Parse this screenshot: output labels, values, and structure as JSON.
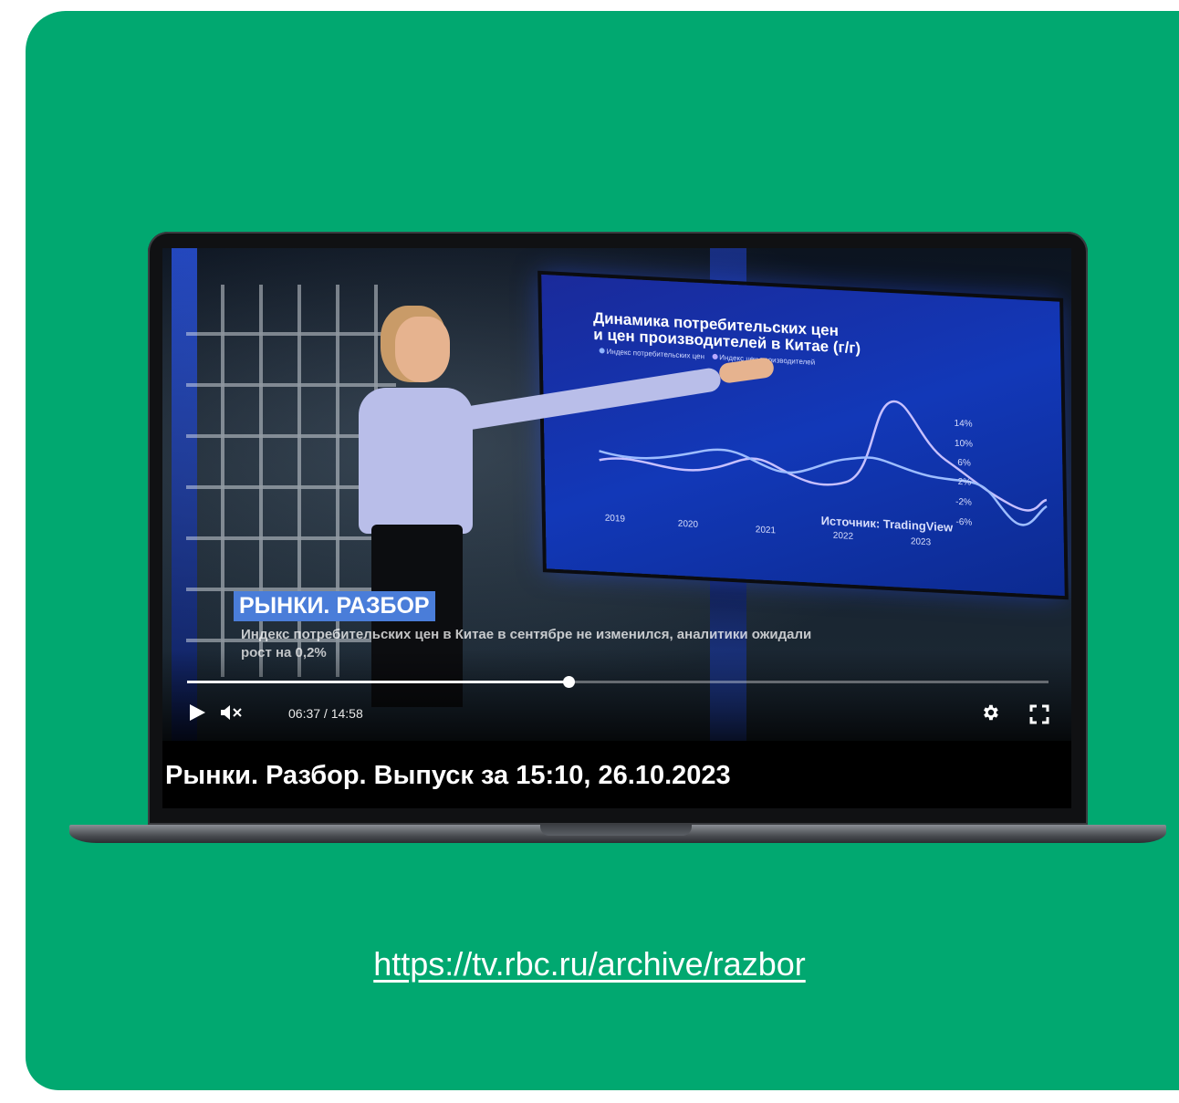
{
  "video": {
    "title": "Рынки. Разбор. Выпуск за 15:10, 26.10.2023",
    "current_time": "06:37",
    "duration": "14:58",
    "time_label": "06:37 / 14:58",
    "progress": 0.443,
    "controls": {
      "play_icon": "play-icon",
      "mute_icon": "volume-muted-icon",
      "settings_icon": "gear-icon",
      "fullscreen_icon": "fullscreen-icon"
    }
  },
  "broadcast": {
    "ticker_title": "РЫНКИ. РАЗБОР",
    "ticker_text": "Индекс потребительских цен в Китае в сентябре не изменился, аналитики ожидали рост на 0,2%",
    "tv_chart": {
      "title_line1": "Динамика потребительских цен",
      "title_line2": "и цен производителей в Китае (г/г)",
      "legend": [
        "Индекс потребительских цен",
        "Индекс цен производителей"
      ],
      "x_labels": [
        "2019",
        "2020",
        "2021",
        "2022",
        "2023"
      ],
      "y_labels": [
        "14%",
        "10%",
        "6%",
        "2%",
        "-2%",
        "-6%"
      ],
      "source": "Источник: TradingView",
      "colors": {
        "cpi": "#8fb4ff",
        "ppi": "#b9a8ff"
      }
    }
  },
  "link": {
    "url_text": "https://tv.rbc.ru/archive/razbor"
  },
  "colors": {
    "background": "#01a870",
    "ticker_accent": "#4a7dd9"
  }
}
